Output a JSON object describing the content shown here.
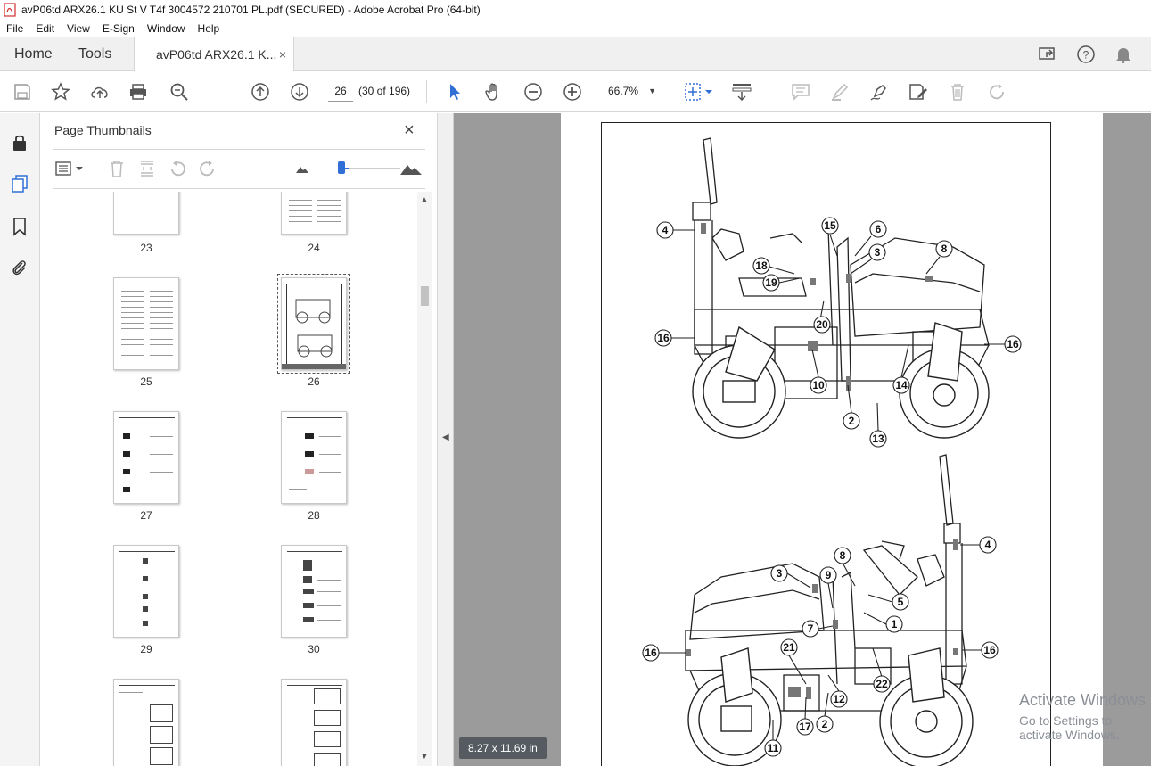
{
  "window": {
    "title": "avP06td ARX26.1 KU St V T4f 3004572 210701 PL.pdf (SECURED) - Adobe Acrobat Pro (64-bit)"
  },
  "menu": [
    "File",
    "Edit",
    "View",
    "E-Sign",
    "Window",
    "Help"
  ],
  "tabs": {
    "home": "Home",
    "tools": "Tools",
    "document": "avP06td ARX26.1 K...",
    "close": "×"
  },
  "toolbar": {
    "page_number": "26",
    "page_count": "(30 of 196)",
    "zoom": "66.7%"
  },
  "panel": {
    "title": "Page Thumbnails",
    "close": "×",
    "thumbnail_size_fraction": 0.1
  },
  "thumbnails": [
    {
      "label": "23",
      "selected": false
    },
    {
      "label": "24",
      "selected": false
    },
    {
      "label": "25",
      "selected": false
    },
    {
      "label": "26",
      "selected": true
    },
    {
      "label": "27",
      "selected": false
    },
    {
      "label": "28",
      "selected": false
    },
    {
      "label": "29",
      "selected": false
    },
    {
      "label": "30",
      "selected": false
    },
    {
      "label": "",
      "selected": false
    },
    {
      "label": "",
      "selected": false
    }
  ],
  "document": {
    "page_size": "8.27 x 11.69 in",
    "callouts_top": [
      "4",
      "15",
      "6",
      "3",
      "8",
      "18",
      "19",
      "20",
      "16",
      "16",
      "14",
      "10",
      "2",
      "13"
    ],
    "callouts_bottom": [
      "4",
      "8",
      "3",
      "9",
      "5",
      "1",
      "7",
      "16",
      "21",
      "16",
      "22",
      "12",
      "2",
      "17",
      "11"
    ]
  },
  "watermark": {
    "line1": "Activate Windows",
    "line2": "Go to Settings to activate Windows."
  },
  "colors": {
    "accent": "#2f6fd6",
    "doc_background": "#9b9b9b",
    "page_size_badge": "#555b61"
  }
}
